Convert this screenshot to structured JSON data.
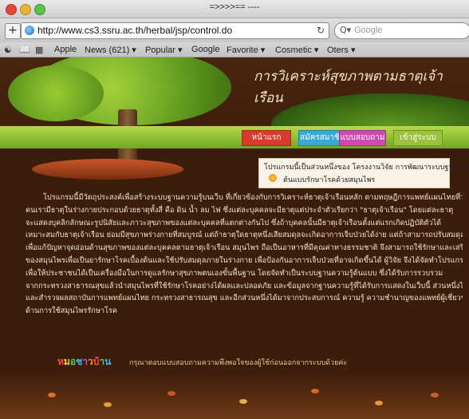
{
  "window": {
    "title": "=>>>>== ----"
  },
  "toolbar": {
    "add_label": "+",
    "url": "http://www.cs3.ssru.ac.th/herbal/jsp/control.do",
    "reload_label": "↻",
    "search_placeholder": "Google"
  },
  "bookmarks": {
    "items": [
      {
        "label": "Apple"
      },
      {
        "label": "News (621) ▾"
      },
      {
        "label": "Popular ▾"
      },
      {
        "label": "Google"
      },
      {
        "label": "Favorite ▾"
      },
      {
        "label": "Cosmetic ▾"
      },
      {
        "label": "Oters ▾"
      }
    ]
  },
  "site": {
    "title": "การวิเคราะห์สุขภาพตามธาตุเจ้าเรือน",
    "nav": [
      {
        "label": "หน้าแรก",
        "color": "#d83a2e"
      },
      {
        "label": "สมัครสมาชิก",
        "color": "#37a8d8"
      },
      {
        "label": "แบบสอบถาม",
        "color": "#cf4ab0"
      },
      {
        "label": "เข้าสู่ระบบ",
        "color": "#9bc23c"
      }
    ],
    "notice": {
      "line1": "โปรแกรมนี้เป็นส่วนหนึ่งของ โครงงานวิจัย การพัฒนาระบบฐานความรู้",
      "line2": "ต้นแบบรักษาโรคด้วยสมุนไพร"
    },
    "body": [
      "โปรแกรมนี้มีวัตถุประสงค์เพื่อสร้างระบบฐานความรู้บนเว็บ ที่เกี่ยวข้องกับการวิเคราะห์ธาตุเจ้าเรือนหลัก ตามทฤษฎีการแพทย์แผนไทยที่ว่า",
      "คนเรามีธาตุในร่างกายประกอบด้วยธาตุทั้งสี่ คือ ดิน น้ำ ลม ไฟ ซึ่งแต่ละบุคคลจะมีธาตุแต่ประจำตัวเรียกว่า \"ธาตุเจ้าเรือน\" โดยแต่ละธาตุ",
      "จะแสดงบุคลิกลักษณะรูปนิสัยและภาวะสุขภาพของแต่ละบุคคลที่แตกต่างกันไป ซึ่งถ้าบุคคลนั้นมีธาตุเจ้าเรือนตั้งแต่แรกเกิดปฏิบัติตัวได้",
      "เหมาะสมกับธาตุเจ้าเรือน ย่อมมีสุขภาพร่างกายที่สมบูรณ์ แต่ถ้าธาตุใดธาตุหนึ่งเสียสมดุลจะเกิดอาการเจ็บป่วยได้ง่าย แต่ถ้าสามารถปรับสมดุลธาตุได้",
      "เพื่อแก้ปัญหาจุดอ่อนด้านสุขภาพของแต่ละบุคคลตามธาตุเจ้าเรือน สมุนไพร ถือเป็นอาหารที่มีคุณค่าทางธรรมชาติ จึงสามารถใช้รักษาและเสริมสร้างดุล",
      "ของสมุนไพรเพื่อเป็นยารักษาโรคเบื้องต้นและใช้ปรับสมดุลภายในร่างกาย เพื่อป้องกันอาการเจ็บป่วยที่อาจเกิดขึ้นได้ ผู้วิจัย จึงได้จัดทำโปรแกรมนี้",
      "เพื่อให้ประชาชนได้เป็นเครื่องมือในการดูแลรักษาสุขภาพตนเองขั้นพื้นฐาน โดยจัดทำเป็นระบบฐานความรู้ต้นแบบ ซึ่งได้รับการรวบรวม",
      "จากกระทรวงสาธารณสุขแล้วนำสมุนไพรที่ใช้รักษาโรคอย่างได้ผลและปลอดภัย และข้อมูลจากฐานความรู้ที่ได้รับการแสดงในเว็บนี้ ส่วนหนึ่งได้รับจาก",
      "และสำรวจผลสถาบันการแพทย์แผนไทย กระทรวงสาธารณสุข และอีกส่วนหนึ่งได้มาจากประสบการณ์ ความรู้ ความชำนาญของแพทย์ผู้เชี่ยวชาญ",
      "ด้านการใช้สมุนไพรรักษาโรค"
    ],
    "survey": {
      "label": "หมอชาวบ้าน",
      "text": "กรุณาตอบแบบสอบถามความพึงพอใจของผู้ใช้ก่อนออกจากระบบด้วยค่ะ"
    }
  },
  "colors": {
    "page_bg": "#3b1d0c",
    "title_text": "#f4e6c0",
    "body_text": "#f1e4c6"
  }
}
